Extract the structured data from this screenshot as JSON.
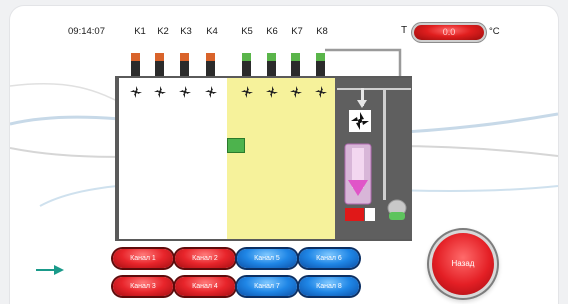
{
  "header": {
    "time": "09:14:07",
    "temperature_label": "T",
    "temperature_value": "0.0",
    "temperature_unit": "°C"
  },
  "channels": [
    "K1",
    "K2",
    "K3",
    "K4",
    "K5",
    "K6",
    "K7",
    "K8"
  ],
  "buttons": {
    "channel_1": "Канал 1",
    "channel_2": "Канал 2",
    "channel_3": "Канал 3",
    "channel_4": "Канал 4",
    "channel_5": "Канал 5",
    "channel_6": "Канал 6",
    "channel_7": "Канал 7",
    "channel_8": "Канал 8",
    "back": "Назад"
  },
  "colors": {
    "red_button": "#e8252b",
    "blue_button": "#1f86e6",
    "zone_yellow": "#f6f29b",
    "valve_cap_orange": "#d9632a",
    "valve_cap_green": "#5ab54a",
    "arrow_teal": "#1a9a8a"
  },
  "icons": {
    "fan": "fan-icon",
    "valve": "valve-icon",
    "arrow": "arrow-right-icon",
    "heater": "heater-icon",
    "flask": "flask-icon",
    "door": "door-icon"
  }
}
